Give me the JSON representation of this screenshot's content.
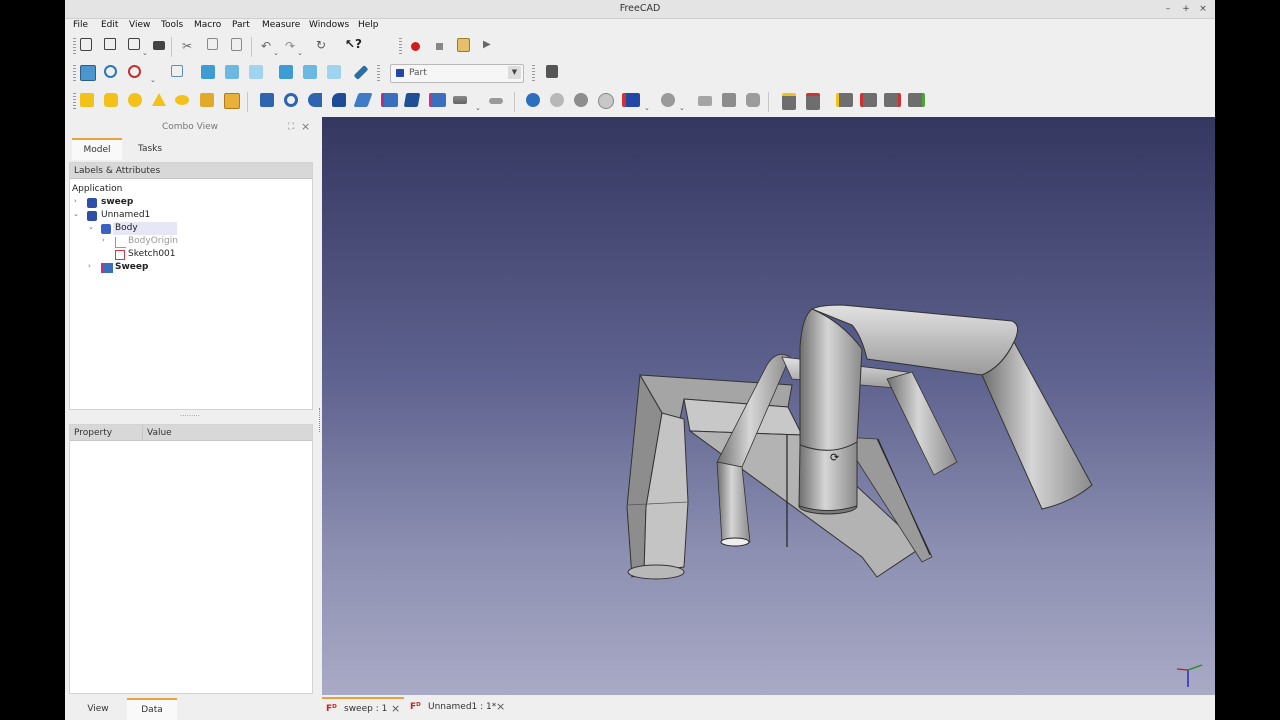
{
  "window": {
    "title": "FreeCAD",
    "minimize": "–",
    "maximize": "+",
    "close": "×"
  },
  "menu": [
    "File",
    "Edit",
    "View",
    "Tools",
    "Macro",
    "Part",
    "Measure",
    "Windows",
    "Help"
  ],
  "workbench": {
    "selected": "Part"
  },
  "combo_view": {
    "title": "Combo View",
    "tabs": [
      "Model",
      "Tasks"
    ],
    "tree_header": "Labels & Attributes",
    "root": "Application",
    "items": [
      {
        "label": "sweep"
      },
      {
        "label": "Unnamed1"
      },
      {
        "label": "Body"
      },
      {
        "label": "BodyOrigin"
      },
      {
        "label": "Sketch001"
      },
      {
        "label": "Sweep"
      }
    ],
    "property_headers": [
      "Property",
      "Value"
    ],
    "splitter_grip": "·········"
  },
  "bottom_tabs": [
    "View",
    "Data"
  ],
  "doc_tabs": [
    {
      "label": "sweep : 1",
      "close": "×"
    },
    {
      "label": "Unnamed1 : 1*",
      "close": "×"
    }
  ],
  "colors": {
    "accent": "#e8a43c",
    "viewport_top": "#343760",
    "viewport_bottom": "#a9aac6"
  }
}
